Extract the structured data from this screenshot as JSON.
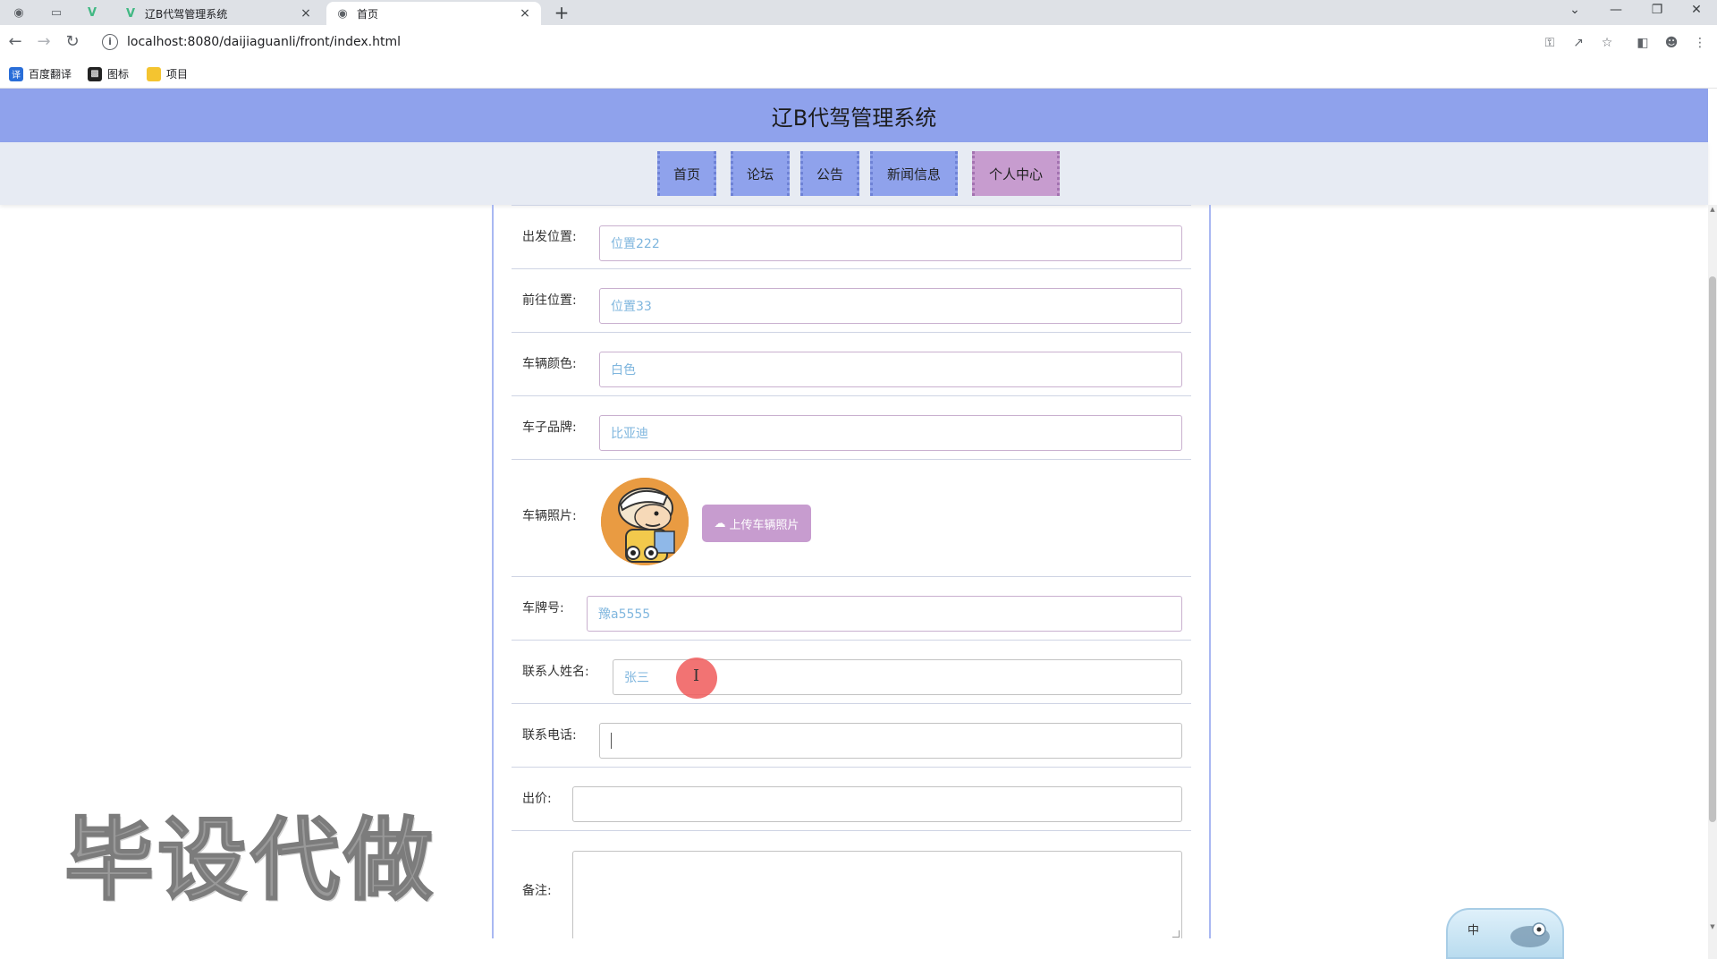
{
  "browser": {
    "tabs": [
      {
        "title": "辽B代驾管理系统",
        "icon": "vue-icon",
        "active": false
      },
      {
        "title": "首页",
        "icon": "globe-icon",
        "active": true
      }
    ],
    "address": "localhost:8080/daijiaguanli/front/index.html",
    "bookmarks": [
      {
        "label": "百度翻译",
        "icon": "translate-icon",
        "color": "#2a6ed8"
      },
      {
        "label": "图标",
        "icon": "image-icon",
        "color": "#222222"
      },
      {
        "label": "项目",
        "icon": "folder-icon",
        "color": "#f4c430"
      }
    ]
  },
  "site": {
    "title": "辽B代驾管理系统",
    "nav": [
      "首页",
      "论坛",
      "公告",
      "新闻信息",
      "个人中心"
    ],
    "nav_active": "个人中心"
  },
  "form": {
    "start_label": "出发位置:",
    "start_value": "位置222",
    "dest_label": "前往位置:",
    "dest_value": "位置33",
    "color_label": "车辆颜色:",
    "color_value": "白色",
    "brand_label": "车子品牌:",
    "brand_value": "比亚迪",
    "photo_label": "车辆照片:",
    "upload_label": "上传车辆照片",
    "plate_label": "车牌号:",
    "plate_value": "豫a5555",
    "contact_label": "联系人姓名:",
    "contact_value": "张三",
    "phone_label": "联系电话:",
    "phone_value": "",
    "price_label": "出价:",
    "price_value": "",
    "remark_label": "备注:"
  },
  "overlay": {
    "watermark": "毕设代做",
    "ime_mode": "中"
  },
  "colors": {
    "header": "#8fa2ec",
    "nav_active": "#c79ccf",
    "input_text": "#7fb6de"
  }
}
